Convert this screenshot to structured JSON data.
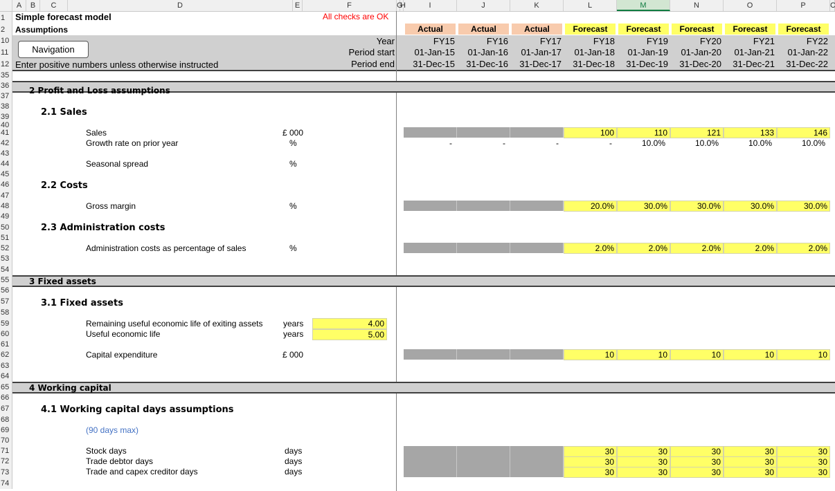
{
  "columns": [
    "A",
    "B",
    "C",
    "D",
    "E",
    "F",
    "G",
    "H",
    "I",
    "J",
    "K",
    "L",
    "M",
    "N",
    "O",
    "P",
    "C"
  ],
  "rows": [
    "1",
    "2",
    "10",
    "11",
    "12",
    "35",
    "36",
    "37",
    "38",
    "39",
    "40",
    "41",
    "42",
    "43",
    "44",
    "45",
    "46",
    "47",
    "48",
    "49",
    "50",
    "51",
    "52",
    "53",
    "54",
    "55",
    "56",
    "57",
    "58",
    "59",
    "60",
    "61",
    "62",
    "63",
    "64",
    "65",
    "66",
    "67",
    "68",
    "69",
    "70",
    "71",
    "72",
    "73",
    "74"
  ],
  "title": "Simple forecast model",
  "subtitle": "Assumptions",
  "checks": "All checks are OK",
  "nav_button": "Navigation",
  "instruction": "Enter positive numbers unless otherwise instructed",
  "labels": {
    "year": "Year",
    "period_start": "Period start",
    "period_end": "Period end"
  },
  "periods": [
    {
      "type": "Actual",
      "fy": "FY15",
      "start": "01-Jan-15",
      "end": "31-Dec-15"
    },
    {
      "type": "Actual",
      "fy": "FY16",
      "start": "01-Jan-16",
      "end": "31-Dec-16"
    },
    {
      "type": "Actual",
      "fy": "FY17",
      "start": "01-Jan-17",
      "end": "31-Dec-17"
    },
    {
      "type": "Forecast",
      "fy": "FY18",
      "start": "01-Jan-18",
      "end": "31-Dec-18"
    },
    {
      "type": "Forecast",
      "fy": "FY19",
      "start": "01-Jan-19",
      "end": "31-Dec-19"
    },
    {
      "type": "Forecast",
      "fy": "FY20",
      "start": "01-Jan-20",
      "end": "31-Dec-20"
    },
    {
      "type": "Forecast",
      "fy": "FY21",
      "start": "01-Jan-21",
      "end": "31-Dec-21"
    },
    {
      "type": "Forecast",
      "fy": "FY22",
      "start": "01-Jan-22",
      "end": "31-Dec-22"
    }
  ],
  "sections": {
    "s2": "2 Profit and Loss assumptions",
    "s21": "2.1  Sales",
    "s22": "2.2  Costs",
    "s23": "2.3  Administration costs",
    "s3": "3 Fixed assets",
    "s31": "3.1  Fixed assets",
    "s4": "4 Working capital",
    "s41": "4.1  Working capital days assumptions"
  },
  "items": {
    "sales": {
      "label": "Sales",
      "unit": "£ 000",
      "values": [
        "100",
        "110",
        "121",
        "133",
        "146"
      ]
    },
    "growth": {
      "label": "Growth rate on prior year",
      "unit": "%",
      "values": [
        "-",
        "-",
        "-",
        "-",
        "10.0%",
        "10.0%",
        "10.0%",
        "10.0%"
      ]
    },
    "seasonal": {
      "label": "Seasonal spread",
      "unit": "%"
    },
    "gross_margin": {
      "label": "Gross margin",
      "unit": "%",
      "values": [
        "20.0%",
        "30.0%",
        "30.0%",
        "30.0%",
        "30.0%"
      ]
    },
    "admin": {
      "label": "Administration costs as percentage of sales",
      "unit": "%",
      "values": [
        "2.0%",
        "2.0%",
        "2.0%",
        "2.0%",
        "2.0%"
      ]
    },
    "remaining_life": {
      "label": "Remaining useful economic life of exiting assets",
      "unit": "years",
      "value": "4.00"
    },
    "useful_life": {
      "label": "Useful economic life",
      "unit": "years",
      "value": "5.00"
    },
    "capex": {
      "label": "Capital expenditure",
      "unit": "£ 000",
      "values": [
        "10",
        "10",
        "10",
        "10",
        "10"
      ]
    },
    "days_note": "(90 days max)",
    "stock": {
      "label": "Stock days",
      "unit": "days",
      "values": [
        "30",
        "30",
        "30",
        "30",
        "30"
      ]
    },
    "debtor": {
      "label": "Trade debtor days",
      "unit": "days",
      "values": [
        "30",
        "30",
        "30",
        "30",
        "30"
      ]
    },
    "creditor": {
      "label": "Trade and capex creditor days",
      "unit": "days",
      "values": [
        "30",
        "30",
        "30",
        "30",
        "30"
      ]
    }
  },
  "colors": {
    "actual_hdr": "#f8cbad",
    "forecast_hdr": "#ffff66",
    "input": "#ffff66",
    "grey": "#a6a6a6",
    "band": "#d0d0d0",
    "check": "#ff0000",
    "note": "#4472c4"
  }
}
